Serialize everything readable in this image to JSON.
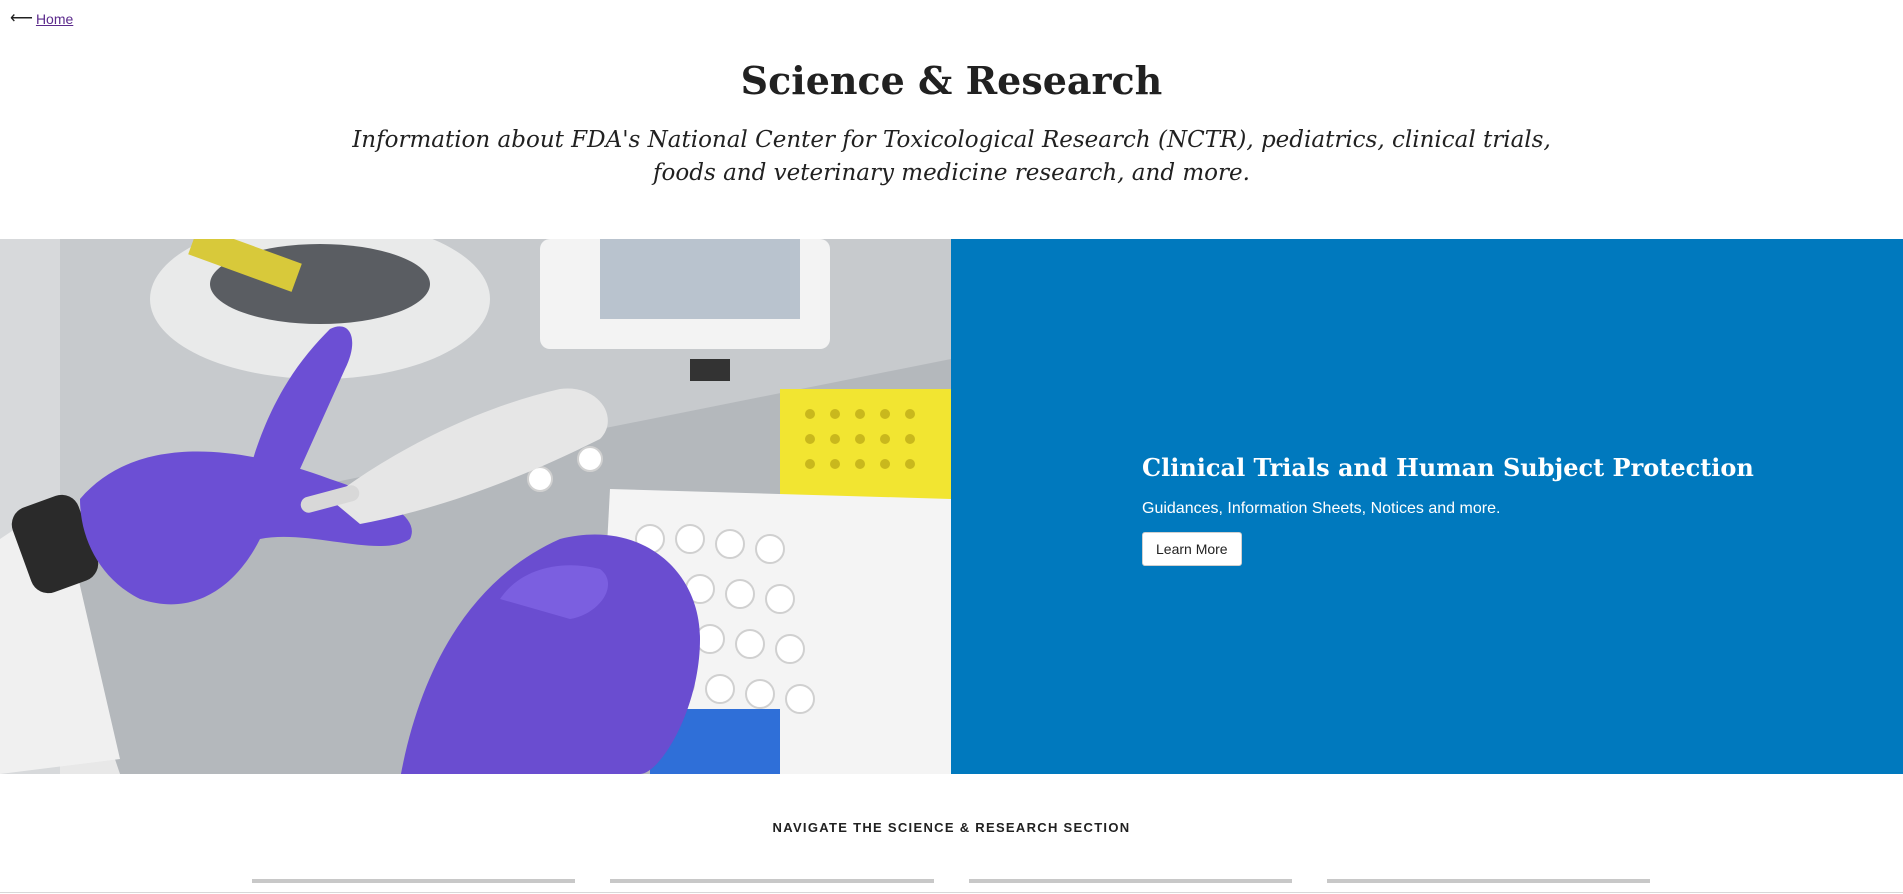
{
  "back_link": {
    "arrow_icon": "left-arrow-icon",
    "label": "Home"
  },
  "page": {
    "title": "Science & Research",
    "subtitle": "Information about FDA's National Center for Toxicological Research (NCTR), pediatrics, clinical trials, foods and veterinary medicine research, and more."
  },
  "hero": {
    "image_alt": "Lab technician in purple gloves using a pipette over sample tubes",
    "title": "Clinical Trials and Human Subject Protection",
    "description": "Guidances, Information Sheets, Notices and more.",
    "button_label": "Learn More",
    "panel_color": "#0079be"
  },
  "navigate": {
    "heading": "NAVIGATE THE SCIENCE & RESEARCH SECTION",
    "cards": [
      "",
      "",
      "",
      ""
    ]
  }
}
